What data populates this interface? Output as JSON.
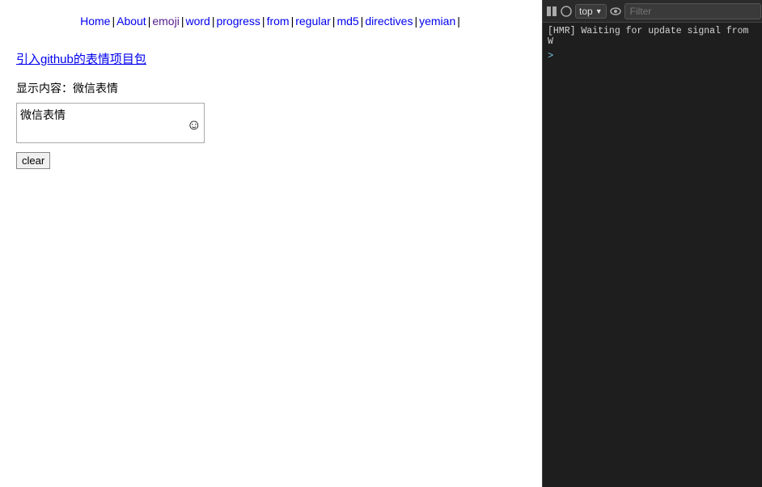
{
  "nav": {
    "items": [
      {
        "label": "Home",
        "href": "#",
        "class": "regular"
      },
      {
        "label": "About",
        "href": "#",
        "class": "regular"
      },
      {
        "label": "emoji",
        "href": "#",
        "class": "emoji"
      },
      {
        "label": "word",
        "href": "#",
        "class": "regular"
      },
      {
        "label": "progress",
        "href": "#",
        "class": "regular"
      },
      {
        "label": "from",
        "href": "#",
        "class": "regular"
      },
      {
        "label": "regular",
        "href": "#",
        "class": "regular"
      },
      {
        "label": "md5",
        "href": "#",
        "class": "regular"
      },
      {
        "label": "directives",
        "href": "#",
        "class": "regular"
      },
      {
        "label": "yemian",
        "href": "#",
        "class": "regular"
      }
    ]
  },
  "github_link": "引入github的表情项目包",
  "display_label": "显示内容：微信表情",
  "input_value": "微信表情",
  "clear_label": "clear",
  "devtools": {
    "top_dropdown": "top",
    "filter_placeholder": "Filter",
    "console_line": "[HMR] Waiting for update signal from W",
    "prompt_symbol": ">"
  }
}
